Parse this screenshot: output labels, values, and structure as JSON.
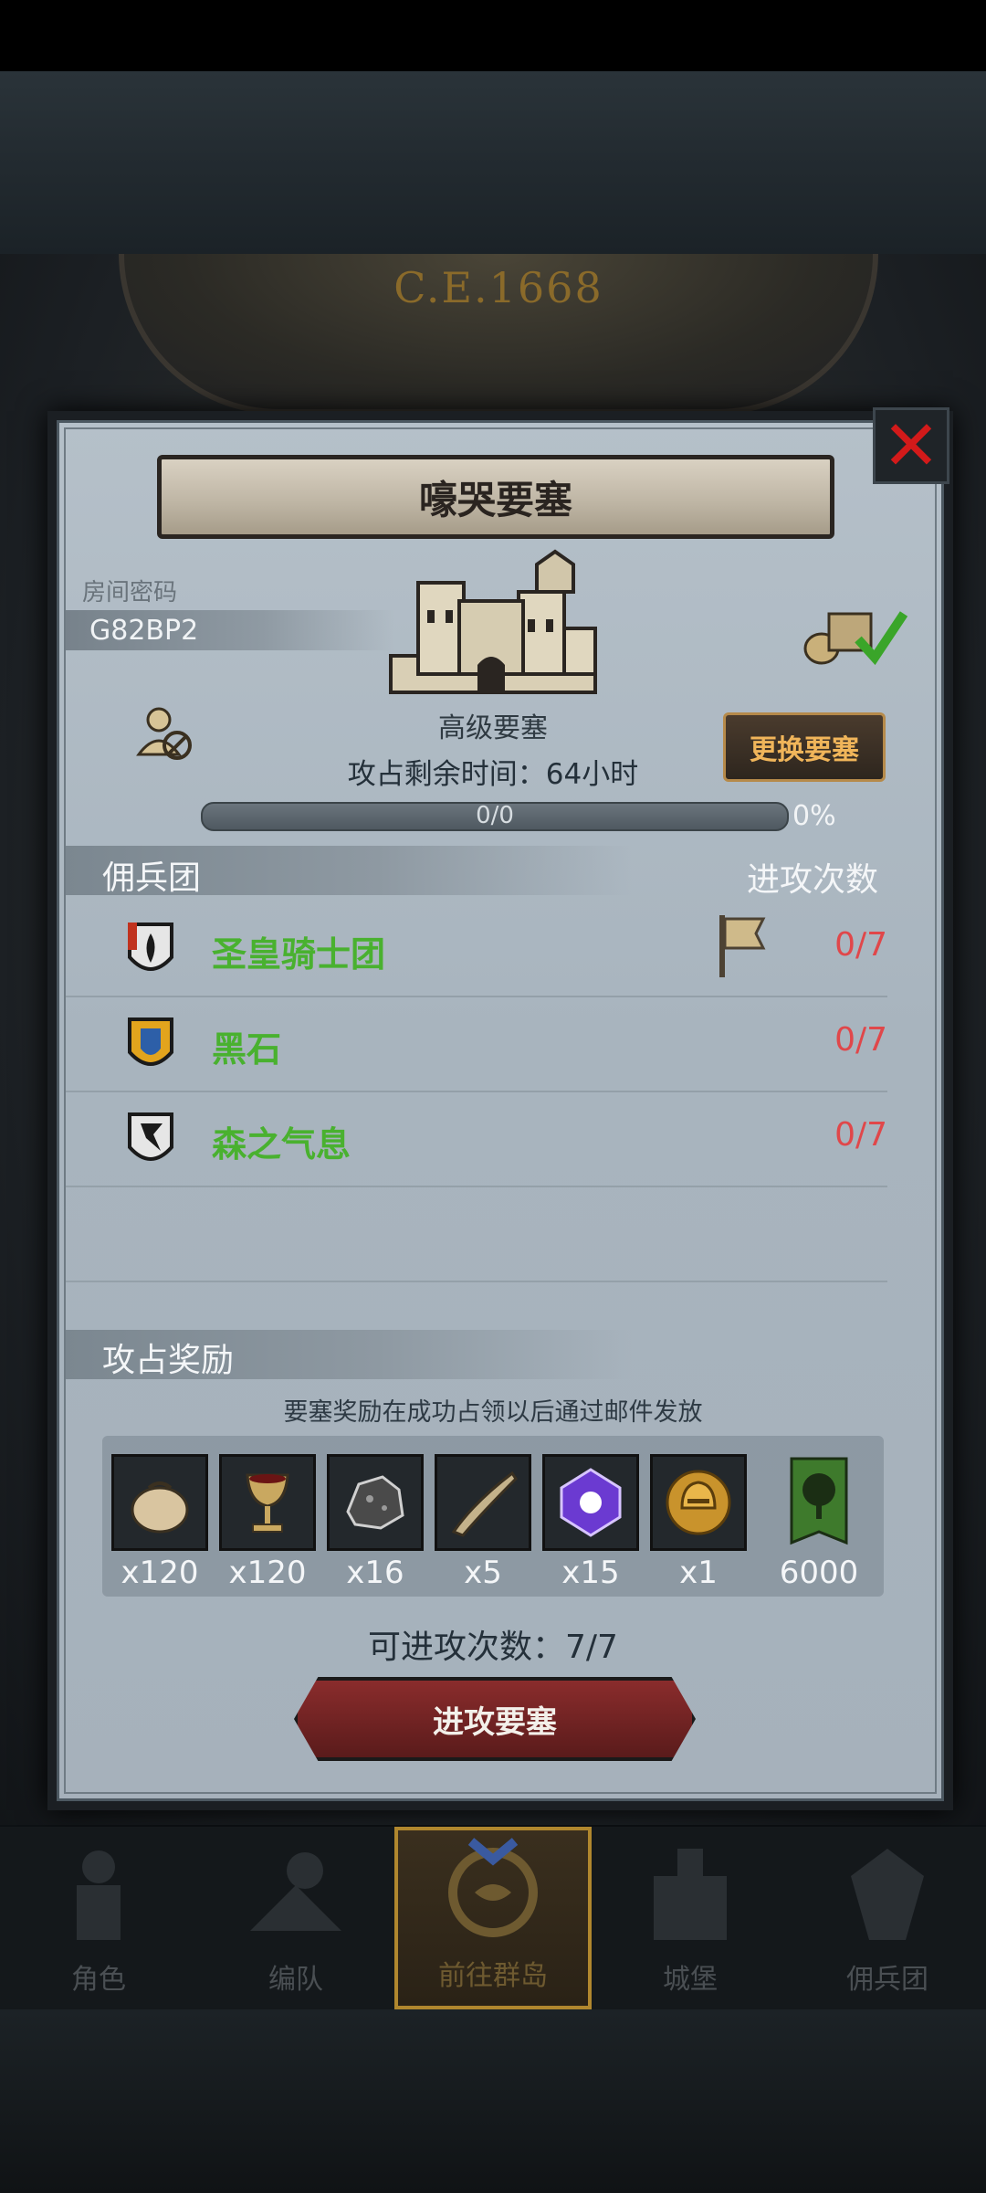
{
  "clock": {
    "year": "C.E.1668"
  },
  "modal": {
    "title": "嚎哭要塞",
    "room_label": "房间密码",
    "room_code": "G82BP2",
    "fortress_name": "高级要塞",
    "time_left": "攻占剩余时间：64小时",
    "progress_text": "0/0",
    "progress_percent": "0%",
    "progress_value": 0,
    "change_button": "更换要塞",
    "merc_header": "佣兵团",
    "attack_count_header": "进攻次数",
    "mercenaries": [
      {
        "name": "圣皇骑士团",
        "count": "0/7",
        "shield": "flame-shield-icon",
        "has_flag": true
      },
      {
        "name": "黑石",
        "count": "0/7",
        "shield": "gold-blue-shield-icon",
        "has_flag": false
      },
      {
        "name": "森之气息",
        "count": "0/7",
        "shield": "wolf-shield-icon",
        "has_flag": false
      }
    ],
    "reward_header": "攻占奖励",
    "reward_note": "要塞奖励在成功占领以后通过邮件发放",
    "rewards": [
      {
        "icon": "coin-bag-icon",
        "qty": "x120"
      },
      {
        "icon": "goblet-icon",
        "qty": "x120"
      },
      {
        "icon": "ore-icon",
        "qty": "x16"
      },
      {
        "icon": "horn-icon",
        "qty": "x5"
      },
      {
        "icon": "purple-crystal-icon",
        "qty": "x15"
      },
      {
        "icon": "golden-helmet-medal-icon",
        "qty": "x1"
      },
      {
        "icon": "tree-banner-icon",
        "qty": "6000"
      }
    ],
    "attacks_left": "可进攻次数：7/7",
    "attack_button": "进攻要塞"
  },
  "nav": [
    {
      "label": "角色",
      "icon": "knight-icon"
    },
    {
      "label": "编队",
      "icon": "formation-icon"
    },
    {
      "label": "前往群岛",
      "icon": "compass-map-icon",
      "active": true
    },
    {
      "label": "城堡",
      "icon": "castle-icon"
    },
    {
      "label": "佣兵团",
      "icon": "mercenary-icon"
    }
  ],
  "colors": {
    "merc_name": "#49b12f",
    "count": "#e0474a",
    "accent": "#b0872e"
  }
}
